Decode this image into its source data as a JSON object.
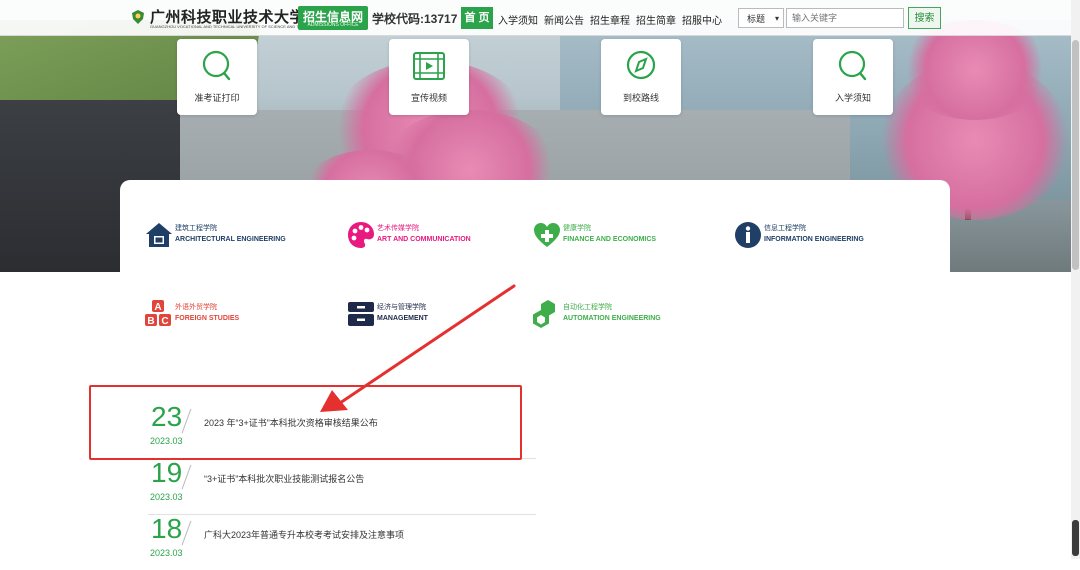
{
  "header": {
    "school_name": "广州科技职业技术大学",
    "school_name_en": "GUANGZHOU VOCATIONAL AND TECHNICAL UNIVERSITY OF SCIENCE AND TECHNOLOGY",
    "admissions_badge": "招生信息网",
    "admissions_badge_en": "ADMISSIONS OFFICE",
    "school_code": "学校代码:13717",
    "nav": {
      "home": "首 页",
      "items": [
        "入学须知",
        "新闻公告",
        "招生章程",
        "招生简章",
        "招服中心"
      ]
    },
    "search": {
      "select_value": "标题",
      "placeholder": "输入关键字",
      "button": "搜索"
    }
  },
  "quick_links": [
    {
      "label": "准考证打印",
      "icon": "search-icon"
    },
    {
      "label": "宣传视频",
      "icon": "film-icon"
    },
    {
      "label": "到校路线",
      "icon": "compass-icon"
    },
    {
      "label": "入学须知",
      "icon": "search-icon"
    }
  ],
  "colleges": [
    {
      "cn": "建筑工程学院",
      "en": "ARCHITECTURAL ENGINEERING",
      "color": "#1f3f66",
      "icon": "house-icon"
    },
    {
      "cn": "艺术传媒学院",
      "en": "ART AND COMMUNICATION",
      "color": "#e8197f",
      "icon": "palette-icon"
    },
    {
      "cn": "健康学院",
      "en": "FINANCE AND ECONOMICS",
      "color": "#3fae4a",
      "icon": "heart-cross-icon"
    },
    {
      "cn": "信息工程学院",
      "en": "INFORMATION ENGINEERING",
      "color": "#1f3f66",
      "icon": "info-icon"
    },
    {
      "cn": "外语外贸学院",
      "en": "FOREIGN STUDIES",
      "color": "#e0443a",
      "icon": "abc-blocks-icon"
    },
    {
      "cn": "经济与管理学院",
      "en": "MANAGEMENT",
      "color": "#1f2a4a",
      "icon": "drawer-icon"
    },
    {
      "cn": "自动化工程学院",
      "en": "AUTOMATION ENGINEERING",
      "color": "#3fae4a",
      "icon": "cubes-icon"
    }
  ],
  "news": [
    {
      "day": "23",
      "ym": "2023.03",
      "title": "2023 年“3+证书”本科批次资格审核结果公布"
    },
    {
      "day": "19",
      "ym": "2023.03",
      "title": "“3+证书”本科批次职业技能测试报名公告"
    },
    {
      "day": "18",
      "ym": "2023.03",
      "title": "广科大2023年普通专升本校考考试安排及注意事项"
    }
  ],
  "colors": {
    "accent": "#2aa34a",
    "annotation": "#e53030"
  }
}
